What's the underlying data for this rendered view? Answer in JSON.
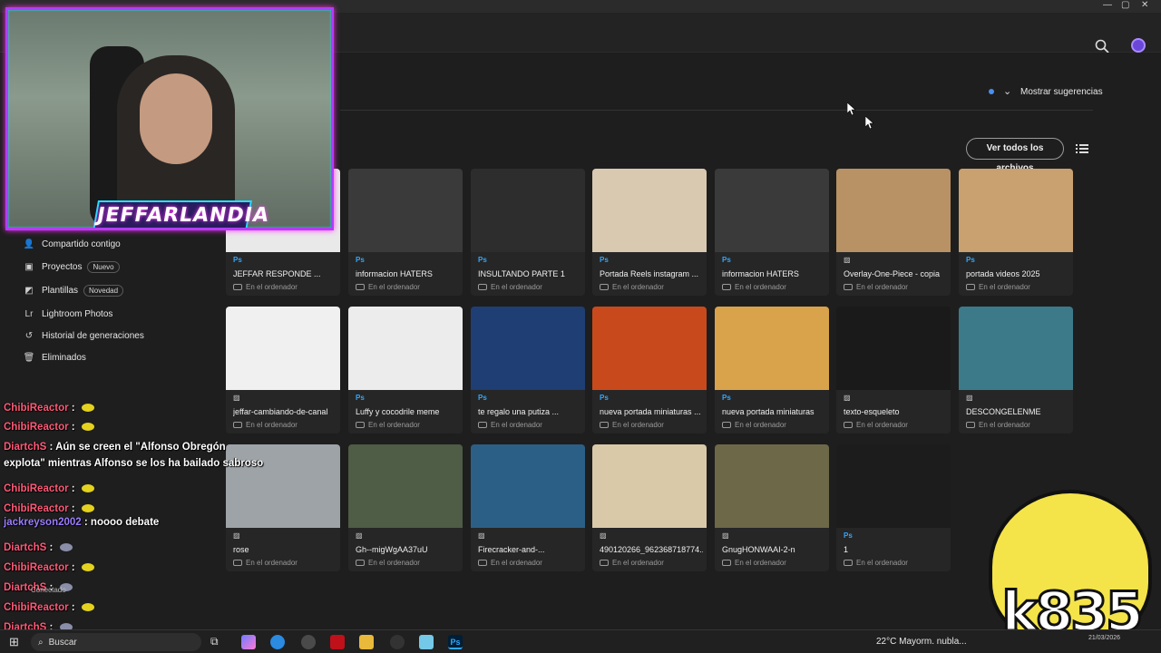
{
  "header": {
    "suggestions_label": "Mostrar sugerencias",
    "view_all_label": "Ver todos los archivos"
  },
  "sidebar": {
    "items": [
      {
        "label": "Compartido contigo",
        "icon": "person-icon"
      },
      {
        "label": "Proyectos",
        "badge": "Nuevo",
        "icon": "projects-icon"
      },
      {
        "label": "Plantillas",
        "badge": "Novedad",
        "icon": "templates-icon"
      },
      {
        "label": "Lightroom Photos",
        "icon": "lightroom-icon"
      },
      {
        "label": "Historial de generaciones",
        "icon": "history-icon"
      },
      {
        "label": "Eliminados",
        "icon": "trash-icon"
      }
    ],
    "status": "Conectado"
  },
  "files": [
    {
      "name": "JEFFAR RESPONDE ...",
      "type": "Ps",
      "location": "En el ordenador",
      "thumb_color": "#e9e9e9"
    },
    {
      "name": "informacion HATERS",
      "type": "Ps",
      "location": "En el ordenador",
      "thumb_color": "#3a3a3a"
    },
    {
      "name": "INSULTANDO PARTE 1",
      "type": "Ps",
      "location": "En el ordenador",
      "thumb_color": "#2d2d2d"
    },
    {
      "name": "Portada Reels instagram ...",
      "type": "Ps",
      "location": "En el ordenador",
      "thumb_color": "#d8c9b0"
    },
    {
      "name": "informacion HATERS",
      "type": "Ps",
      "location": "En el ordenador",
      "thumb_color": "#3a3a3a"
    },
    {
      "name": "Overlay-One-Piece - copia",
      "type": "img",
      "location": "En el ordenador",
      "thumb_color": "#b89265"
    },
    {
      "name": "portada videos 2025",
      "type": "Ps",
      "location": "En el ordenador",
      "thumb_color": "#c9a070"
    },
    {
      "name": "jeffar-cambiando-de-canal",
      "type": "img",
      "location": "En el ordenador",
      "thumb_color": "#f0f0f0"
    },
    {
      "name": "Luffy y cocodrile meme",
      "type": "Ps",
      "location": "En el ordenador",
      "thumb_color": "#ececec"
    },
    {
      "name": "te regalo una putiza ...",
      "type": "Ps",
      "location": "En el ordenador",
      "thumb_color": "#1f3e73"
    },
    {
      "name": "nueva portada miniaturas ...",
      "type": "Ps",
      "location": "En el ordenador",
      "thumb_color": "#c84a1c"
    },
    {
      "name": "nueva portada miniaturas",
      "type": "Ps",
      "location": "En el ordenador",
      "thumb_color": "#d8a34a"
    },
    {
      "name": "texto-esqueleto",
      "type": "img",
      "location": "En el ordenador",
      "thumb_color": "#1a1a1a"
    },
    {
      "name": "DESCONGELENME",
      "type": "img",
      "location": "En el ordenador",
      "thumb_color": "#3c7a8a"
    },
    {
      "name": "rose",
      "type": "img",
      "location": "En el ordenador",
      "thumb_color": "#9ea3a8"
    },
    {
      "name": "Gh--migWgAA37uU",
      "type": "img",
      "location": "En el ordenador",
      "thumb_color": "#4f5c46"
    },
    {
      "name": "Firecracker-and-...",
      "type": "img",
      "location": "En el ordenador",
      "thumb_color": "#2c5f86"
    },
    {
      "name": "490120266_962368718774...",
      "type": "img",
      "location": "En el ordenador",
      "thumb_color": "#d9c9a8"
    },
    {
      "name": "GnugHONWAAI-2-n",
      "type": "img",
      "location": "En el ordenador",
      "thumb_color": "#6d6848"
    },
    {
      "name": "1",
      "type": "Ps",
      "location": "En el ordenador",
      "thumb_color": "#1c1c1c"
    }
  ],
  "overlay": {
    "channel_logo": "JEFFARLANDIA",
    "mascot_text": "k835",
    "chat": [
      {
        "user": "ChibiReactor",
        "text": "",
        "emote": "yellow"
      },
      {
        "user": "ChibiReactor",
        "text": "",
        "emote": "yellow"
      },
      {
        "user": "DiartchS",
        "text": "Aún se creen el \"Alfonso Obregón",
        "emote": ""
      },
      {
        "user": "",
        "text": "explota\" mientras Alfonso se los ha bailado sabroso",
        "emote": ""
      },
      {
        "user": "ChibiReactor",
        "text": "",
        "emote": "yellow"
      },
      {
        "user": "ChibiReactor",
        "text": "",
        "emote": "yellow"
      },
      {
        "user": "jackreyson2002",
        "text": "noooo debate",
        "emote": ""
      },
      {
        "user": "DiartchS",
        "text": "",
        "emote": "gray"
      },
      {
        "user": "ChibiReactor",
        "text": "",
        "emote": "yellow"
      },
      {
        "user": "DiartchS",
        "text": "",
        "emote": "gray"
      },
      {
        "user": "ChibiReactor",
        "text": "",
        "emote": "yellow"
      },
      {
        "user": "DiartchS",
        "text": "",
        "emote": "gray"
      }
    ]
  },
  "taskbar": {
    "search_label": "Buscar",
    "weather": "22°C  Mayorm. nubla...",
    "date": "21/03/2026"
  }
}
